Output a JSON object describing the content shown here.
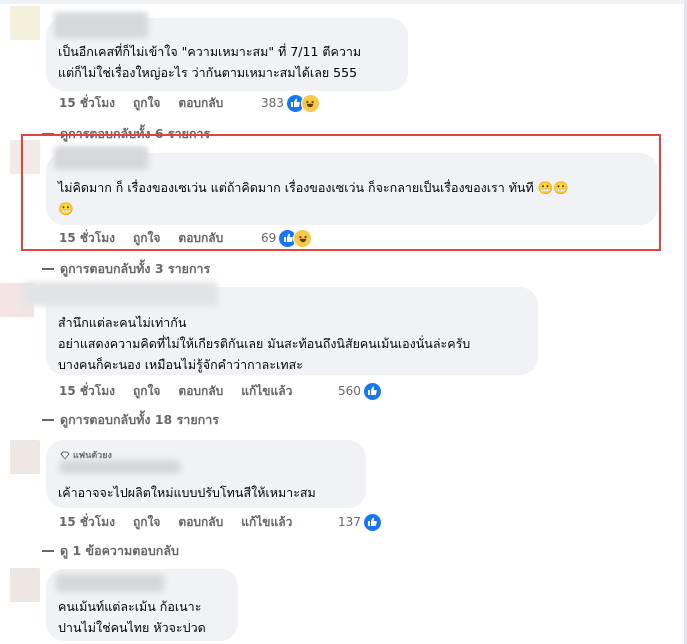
{
  "comments": [
    {
      "text": "เป็นอีกเคสที่ก็ไม่เข้าใจ \"ความเหมาะสม\" ที่ 7/11 ตีความ\nแต่ก็ไม่ใช่เรื่องใหญ่อะไร ว่ากันตามเหมาะสมได้เลย 555",
      "time": "15 ชั่วโมง",
      "like": "ถูกใจ",
      "reply": "ตอบกลับ",
      "reactions": "383",
      "reaction_icons": [
        "like-icon",
        "haha-icon"
      ]
    },
    {
      "text": "ไม่คิดมาก ก็ เรื่องของเซเว่น แต่ถ้าคิดมาก เรื่องของเซเว่น ก็จะกลายเป็นเรื่องของเรา ทันที 😬😬\n😬",
      "time": "15 ชั่วโมง",
      "like": "ถูกใจ",
      "reply": "ตอบกลับ",
      "reactions": "69",
      "reaction_icons": [
        "like-icon",
        "haha-icon"
      ]
    },
    {
      "text": "สำนึกแต่ละคนไม่เท่ากัน\nอย่าแสดงความคิดที่ไม่ให้เกียรติกันเลย มันสะท้อนถึงนิสัยคนเม้นเองนั่นล่ะครับ\nบางคนก็คะนอง เหมือนไม่รู้จักคำว่ากาละเทสะ",
      "time": "15 ชั่วโมง",
      "like": "ถูกใจ",
      "reply": "ตอบกลับ",
      "edited": "แก้ไขแล้ว",
      "reactions": "560",
      "reaction_icons": [
        "like-icon"
      ]
    },
    {
      "badge": "แฟนตัวยง",
      "text": "เค้าอาจจะไปผลิตใหม่แบบปรับโทนสีให้เหมาะสม",
      "time": "15 ชั่วโมง",
      "like": "ถูกใจ",
      "reply": "ตอบกลับ",
      "edited": "แก้ไขแล้ว",
      "reactions": "137",
      "reaction_icons": [
        "like-icon"
      ]
    },
    {
      "text": "คนเม้นท์แต่ละเม้น ก้อเนาะ\nปานไม่ใช่คนไทย หัวจะปวด"
    }
  ],
  "view_replies": [
    "ดูการตอบกลับทั้ง 6 รายการ",
    "ดูการตอบกลับทั้ง 3 รายการ",
    "ดูการตอบกลับทั้ง 18 รายการ",
    "ดู 1 ข้อความตอบกลับ"
  ],
  "colors": {
    "highlight": "#e0443e",
    "like": "#1877f2",
    "haha": "#f7c948",
    "bubble": "#f0f2f5",
    "meta": "#65676b"
  }
}
